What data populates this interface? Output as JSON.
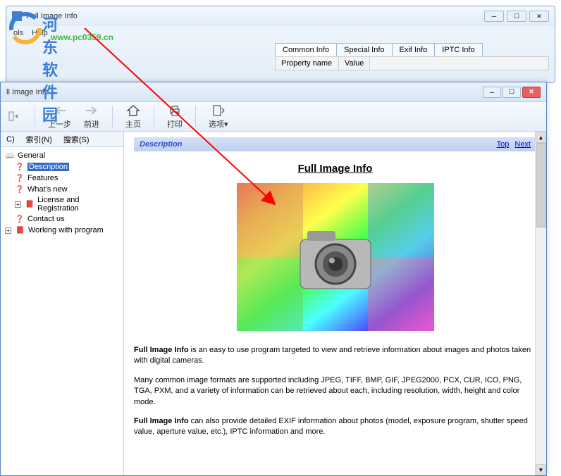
{
  "bg_window": {
    "title": "Full Image Info",
    "menu": [
      "ols",
      "Help"
    ],
    "tabs": [
      "Common Info",
      "Special Info",
      "Exif Info",
      "IPTC Info"
    ],
    "prop_headers": [
      "Property name",
      "Value"
    ]
  },
  "watermark": {
    "text": "河东软件园",
    "url": "www.pc0359.cn"
  },
  "help_window": {
    "title": "ll Image Info",
    "toolbar": {
      "hide": "",
      "back": "上一步",
      "forward": "前进",
      "home": "主页",
      "print": "打印",
      "options": "选项"
    },
    "nav_tabs": [
      "C)",
      "索引(N)",
      "搜索(S)"
    ],
    "tree": {
      "general": "General",
      "description": "Description",
      "features": "Features",
      "whatsnew": "What's new",
      "license": "License and Registration",
      "contact": "Contact us",
      "working": "Working with program"
    },
    "content": {
      "header": "Description",
      "link_top": "Top",
      "link_next": "Next",
      "title": "Full Image Info",
      "para1_bold": "Full Image Info",
      "para1_rest": " is an easy to use program targeted to view and retrieve information about images and photos taken with digital cameras.",
      "para2": "Many common image formats are supported including JPEG, TIFF, BMP, GIF, JPEG2000, PCX, CUR, ICO, PNG, TGA, PXM, and a variety of information can be retrieved about each, including resolution, width, height and color mode.",
      "para3_bold": "Full Image Info",
      "para3_rest": " can also provide detailed EXIF information about photos (model, exposure program, shutter speed value, aperture value, etc.), IPTC information and more."
    }
  }
}
